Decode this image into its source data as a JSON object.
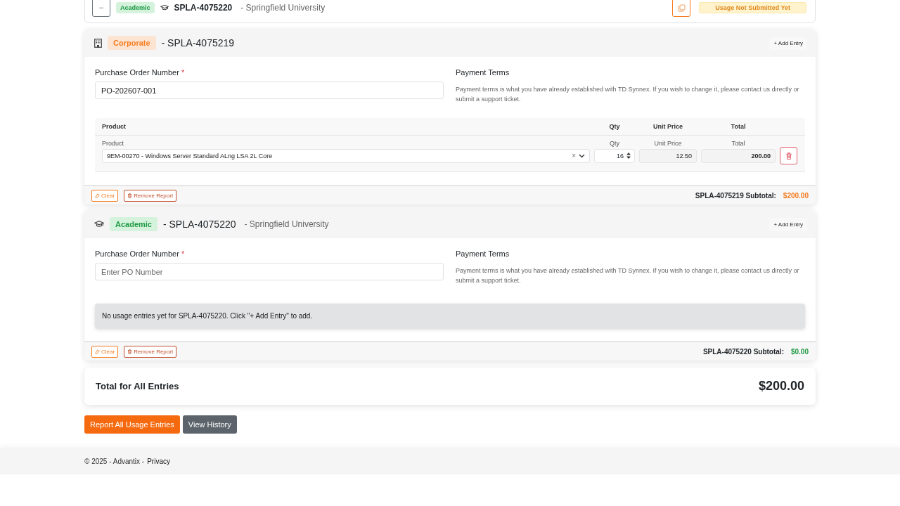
{
  "collapsed_report": {
    "collapse_button": "−",
    "badge": "Academic",
    "kind": "academic",
    "code": "SPLA-4075220",
    "org": "- Springfield University",
    "status": "Usage Not Submitted Yet"
  },
  "reports": [
    {
      "kind": "corporate",
      "badge": "Corporate",
      "title": "- SPLA-4075219",
      "add_button": "+ Add Entry",
      "po_label": "Purchase Order Number",
      "required_mark": "*",
      "po_value": "PO-202607-001",
      "terms_label": "Payment Terms",
      "terms_text": "Payment terms is what you have already established with TD Synnex. If you wish to change it, please contact us directly or submit a support ticket.",
      "columns": [
        "Product",
        "Qty",
        "Unit Price",
        "Total"
      ],
      "entries": [
        {
          "labels": [
            "Product",
            "Qty",
            "Unit Price",
            "Total"
          ],
          "product": "9EM-00270 - Windows Server Standard ALng LSA 2L Core",
          "clear": "×",
          "qty": "16",
          "unit_price": "12.50",
          "total": "200.00"
        }
      ],
      "clear_button": "Clear",
      "remove_button": "Remove Report",
      "subtotal_label": "SPLA-4075219 Subtotal:",
      "subtotal": "$200.00"
    },
    {
      "kind": "academic",
      "badge": "Academic",
      "title": "- SPLA-4075220",
      "org": "- Springfield University",
      "add_button": "+ Add Entry",
      "po_label": "Purchase Order Number",
      "required_mark": "*",
      "po_placeholder": "Enter PO Number",
      "terms_label": "Payment Terms",
      "terms_text": "Payment terms is what you have already established with TD Synnex. If you wish to change it, please contact us directly or submit a support ticket.",
      "empty_message": "No usage entries yet for SPLA-4075220. Click \"+ Add Entry\" to add.",
      "clear_button": "Clear",
      "remove_button": "Remove Report",
      "subtotal_label": "SPLA-4075220 Subtotal:",
      "subtotal": "$0.00"
    }
  ],
  "total": {
    "label": "Total for All Entries",
    "value": "$200.00"
  },
  "actions": [
    {
      "kind": "primary",
      "label": "Report All Usage Entries"
    },
    {
      "kind": "secondary",
      "label": "View History"
    }
  ],
  "footer": {
    "text": "© 2025 - Advantix -",
    "link": "Privacy"
  }
}
